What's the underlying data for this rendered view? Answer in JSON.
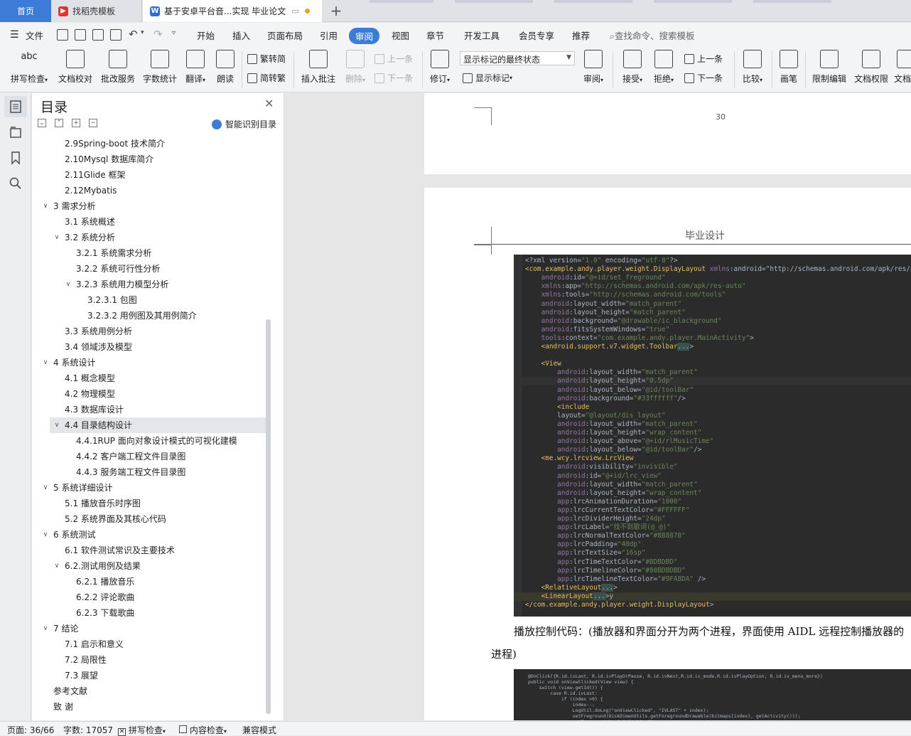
{
  "tabs": {
    "home": "首页",
    "templates": "找稻壳模板",
    "document": "基于安卓平台音...实现 毕业论文",
    "new_tab": "+"
  },
  "menu": {
    "file": "文件",
    "items": [
      "开始",
      "插入",
      "页面布局",
      "引用",
      "审阅",
      "视图",
      "章节",
      "开发工具",
      "会员专享",
      "推荐"
    ],
    "active": "审阅",
    "search_placeholder": "查找命令、搜索模板"
  },
  "ribbon": {
    "spell_check": "拼写检查",
    "doc_proof": "文档校对",
    "batch_service": "批改服务",
    "word_count": "字数统计",
    "translate": "翻译",
    "read_aloud": "朗读",
    "trad_to_simp": "繁转简",
    "simp_to_trad": "简转繁",
    "insert_comment": "插入批注",
    "delete": "删除",
    "prev_comment": "上一条",
    "next_comment": "下一条",
    "track_changes": "修订",
    "markup_state": "显示标记的最终状态",
    "show_markup": "显示标记",
    "review": "审阅",
    "accept": "接受",
    "reject": "拒绝",
    "prev_change": "上一条",
    "next_change": "下一条",
    "compare": "比较",
    "ink": "画笔",
    "restrict_edit": "限制编辑",
    "doc_permission": "文档权限",
    "doc_more": "文档"
  },
  "toc": {
    "title": "目录",
    "smart_toc": "智能识别目录",
    "items": [
      {
        "label": "2.9Spring-boot 技术简介",
        "level": 2
      },
      {
        "label": "2.10Mysql 数据库简介",
        "level": 2
      },
      {
        "label": "2.11Glide 框架",
        "level": 2
      },
      {
        "label": "2.12Mybatis",
        "level": 2
      },
      {
        "label": "3 需求分析",
        "level": 1,
        "expanded": true
      },
      {
        "label": "3.1 系统概述",
        "level": 2
      },
      {
        "label": "3.2 系统分析",
        "level": 2,
        "expanded": true
      },
      {
        "label": "3.2.1 系统需求分析",
        "level": 3
      },
      {
        "label": "3.2.2 系统可行性分析",
        "level": 3
      },
      {
        "label": "3.2.3 系统用力模型分析",
        "level": 3,
        "expanded": true
      },
      {
        "label": "3.2.3.1 包图",
        "level": 4
      },
      {
        "label": "3.2.3.2 用例图及其用例简介",
        "level": 4
      },
      {
        "label": "3.3 系统用例分析",
        "level": 2
      },
      {
        "label": "3.4 领域涉及模型",
        "level": 2
      },
      {
        "label": "4 系统设计",
        "level": 1,
        "expanded": true
      },
      {
        "label": "4.1 概念模型",
        "level": 2
      },
      {
        "label": "4.2 物理模型",
        "level": 2
      },
      {
        "label": "4.3  数据库设计",
        "level": 2
      },
      {
        "label": "4.4  目录结构设计",
        "level": 2,
        "expanded": true,
        "selected": true
      },
      {
        "label": "4.4.1RUP 面向对象设计模式的可视化建模",
        "level": 3
      },
      {
        "label": "4.4.2 客户端工程文件目录图",
        "level": 3
      },
      {
        "label": "4.4.3 服务端工程文件目录图",
        "level": 3
      },
      {
        "label": "5 系统详细设计",
        "level": 1,
        "expanded": true
      },
      {
        "label": "5.1 播放音乐时序图",
        "level": 2
      },
      {
        "label": "5.2 系统界面及其核心代码",
        "level": 2
      },
      {
        "label": "6 系统测试",
        "level": 1,
        "expanded": true
      },
      {
        "label": "6.1  软件测试常识及主要技术",
        "level": 2
      },
      {
        "label": "6.2.测试用例及结果",
        "level": 2,
        "expanded": true
      },
      {
        "label": "6.2.1 播放音乐",
        "level": 3
      },
      {
        "label": "6.2.2 评论歌曲",
        "level": 3
      },
      {
        "label": "6.2.3 下载歌曲",
        "level": 3
      },
      {
        "label": "7 结论",
        "level": 1,
        "expanded": true
      },
      {
        "label": "7.1 启示和意义",
        "level": 2
      },
      {
        "label": "7.2 局限性",
        "level": 2
      },
      {
        "label": "7.3 展望",
        "level": 2
      },
      {
        "label": "参考文献",
        "level": 1
      },
      {
        "label": "致    谢",
        "level": 1
      }
    ]
  },
  "document": {
    "page_number": "30",
    "header": "毕业设计",
    "code_lines": [
      "<?xml version=\"1.0\" encoding=\"utf-8\"?>",
      "<com.example.andy.player.weight.DisplayLayout xmlns:android=\"http://schemas.android.com/apk/res/an",
      "    android:id=\"@+id/set_freground\"",
      "    xmlns:app=\"http://schemas.android.com/apk/res-auto\"",
      "    xmlns:tools=\"http://schemas.android.com/tools\"",
      "    android:layout_width=\"match_parent\"",
      "    android:layout_height=\"match_parent\"",
      "    android:background=\"@drawable/ic_blackground\"",
      "    android:fitsSystemWindows=\"true\"",
      "    tools:context=\"com.example.andy.player.MainActivity\">",
      "    <android.support.v7.widget.Toolbar...>",
      "",
      "    <View",
      "        android:layout_width=\"match_parent\"",
      "        android:layout_height=\"0.5dp\"",
      "        android:layout_below=\"@id/toolBar\"",
      "        android:background=\"#33ffffff\"/>",
      "        <include",
      "        layout=\"@layout/dis_layout\"",
      "        android:layout_width=\"match_parent\"",
      "        android:layout_height=\"wrap_content\"",
      "        android:layout_above=\"@+id/rlMusicTime\"",
      "        android:layout_below=\"@id/toolBar\"/>",
      "    <me.wcy.lrcview.LrcView",
      "        android:visibility=\"invisible\"",
      "        android:id=\"@+id/lrc_view\"",
      "        android:layout_width=\"match_parent\"",
      "        android:layout_height=\"wrap_content\"",
      "        app:lrcAnimationDuration=\"1000\"",
      "        app:lrcCurrentTextColor=\"#FFFFFF\"",
      "        app:lrcDividerHeight=\"24dp\"",
      "        app:lrcLabel=\"找不到歌词(@_@)\"",
      "        app:lrcNormalTextColor=\"#8B8878\"",
      "        app:lrcPadding=\"40dp\"",
      "        app:lrcTextSize=\"16sp\"",
      "        app:lrcTimeTextColor=\"#BDBDBD\"",
      "        app:lrcTimelineColor=\"#80BDBDBD\"",
      "        app:lrcTimelineTextColor=\"#9FA8DA\" />",
      "    <RelativeLayout...>",
      "    <LinearLayout...>y",
      "</com.example.andy.player.weight.DisplayLayout>"
    ],
    "paragraph_line1": "播放控制代码：(播放器和界面分开为两个进程，界面使用 AIDL 远程控制播放器的",
    "paragraph_line2": "进程)",
    "code2_lines": [
      "@OnClick({R.id.ivLast, R.id.ivPlayOrPause, R.id.ivNext,R.id.iv_mode,R.id.ivPlayOption, R.id.iv_menu_more})",
      "public void onViewClicked(View view) {",
      "    switch (view.getId()) {",
      "        case R.id.ivLast:",
      "            if (index >0) {",
      "                index--;",
      "                LogUtil.doLog(\"onViewClicked\", \"IVLAST\" + index);",
      "                setFreground(DiskDimenUtils.getForegroundDrawable(bitmaps[index], getActivity()));",
      "                setFreground.beginAnimation();"
    ]
  },
  "status": {
    "page": "页面: 36/66",
    "words": "字数: 17057",
    "spell": "拼写检查",
    "content": "内容检查",
    "compat": "兼容模式"
  },
  "colors": {
    "accent": "#3d7bd9",
    "code_bg": "#2b2b2b"
  }
}
